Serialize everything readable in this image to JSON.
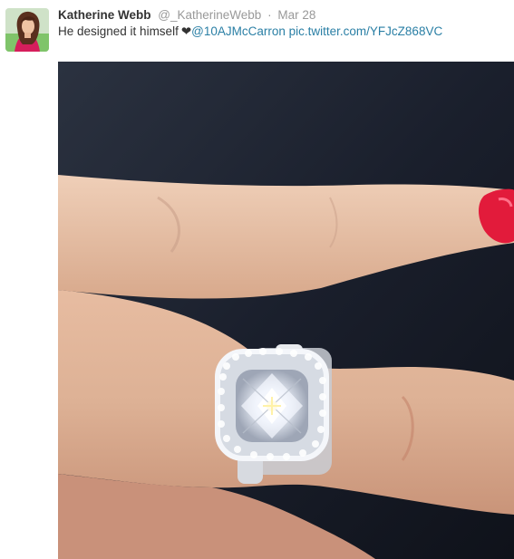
{
  "tweet": {
    "fullname": "Katherine Webb",
    "username": "@_KatherineWebb",
    "separator": "·",
    "timestamp": "Mar 28",
    "text": "He designed it himself",
    "heart": "❤",
    "mention": "@10AJMcCarron",
    "media_link": "pic.twitter.com/YFJcZ868VC",
    "avatar_icon": "user-avatar",
    "photo_icon": "ring-photo"
  }
}
